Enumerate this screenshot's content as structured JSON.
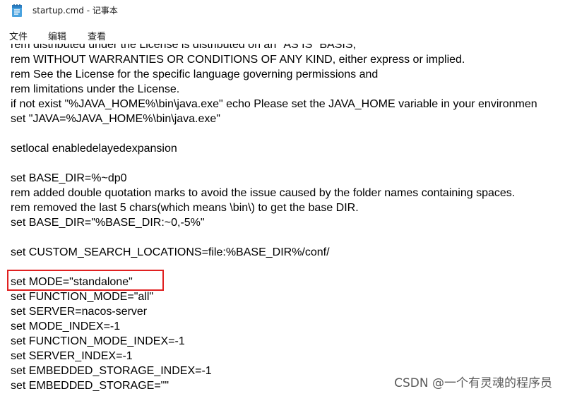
{
  "window": {
    "title": "startup.cmd - 记事本",
    "icon": "notepad-icon"
  },
  "menu": {
    "items": [
      "文件",
      "编辑",
      "查看"
    ]
  },
  "editor": {
    "lines": [
      "rem distributed under the License is distributed on an \"AS IS\" BASIS,",
      "rem WITHOUT WARRANTIES OR CONDITIONS OF ANY KIND, either express or implied.",
      "rem See the License for the specific language governing permissions and",
      "rem limitations under the License.",
      "if not exist \"%JAVA_HOME%\\bin\\java.exe\" echo Please set the JAVA_HOME variable in your environmen",
      "set \"JAVA=%JAVA_HOME%\\bin\\java.exe\"",
      "",
      "setlocal enabledelayedexpansion",
      "",
      "set BASE_DIR=%~dp0",
      "rem added double quotation marks to avoid the issue caused by the folder names containing spaces.",
      "rem removed the last 5 chars(which means \\bin\\) to get the base DIR.",
      "set BASE_DIR=\"%BASE_DIR:~0,-5%\"",
      "",
      "set CUSTOM_SEARCH_LOCATIONS=file:%BASE_DIR%/conf/",
      "",
      "set MODE=\"standalone\"",
      "set FUNCTION_MODE=\"all\"",
      "set SERVER=nacos-server",
      "set MODE_INDEX=-1",
      "set FUNCTION_MODE_INDEX=-1",
      "set SERVER_INDEX=-1",
      "set EMBEDDED_STORAGE_INDEX=-1",
      "set EMBEDDED_STORAGE=\"\""
    ],
    "highlighted_line_index": 16,
    "highlight_color": "#e02020"
  },
  "watermark": "CSDN @一个有灵魂的程序员"
}
